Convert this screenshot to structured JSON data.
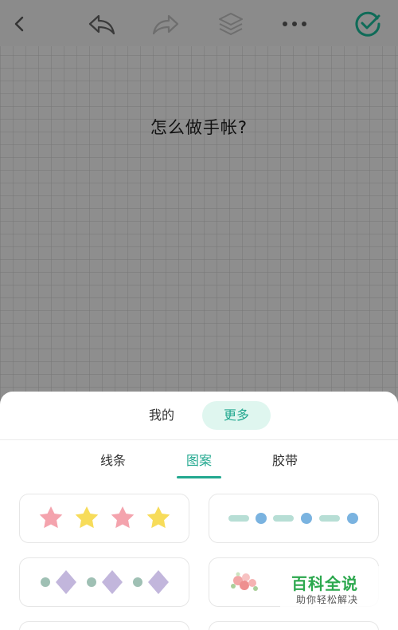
{
  "toolbar": {
    "back_icon": "chevron-left-icon",
    "undo_icon": "undo-icon",
    "redo_icon": "redo-icon",
    "layers_icon": "layers-icon",
    "more_icon": "more-icon",
    "confirm_icon": "check-circle-icon"
  },
  "canvas": {
    "text": "怎么做手帐?"
  },
  "sheet": {
    "tabs": {
      "mine": "我的",
      "more": "更多"
    },
    "categories": [
      "线条",
      "图案",
      "胶带"
    ],
    "active_category": "图案"
  },
  "watermark": {
    "title": "百科全说",
    "subtitle": "助你轻松解决"
  },
  "colors": {
    "accent": "#22a88f",
    "accent_bg": "#dff6ef",
    "star_pink": "#f4a3ad",
    "star_yellow": "#f7dc5a",
    "dash_teal": "#b7ded5",
    "dot_blue": "#7ab3e0",
    "dot_sage": "#9fc0b4",
    "diamond_lilac": "#c2b6dc"
  }
}
